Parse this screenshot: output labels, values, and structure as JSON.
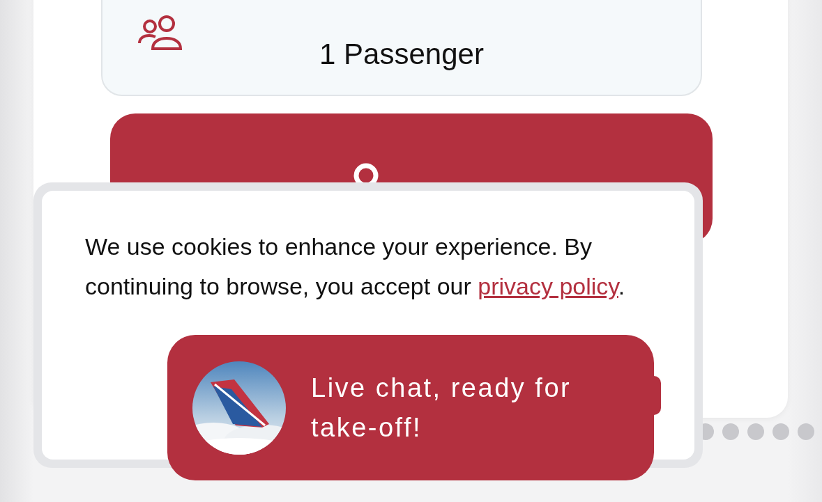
{
  "booking_form": {
    "passengers_field": {
      "value": "1 Passenger"
    }
  },
  "cookie_banner": {
    "text_before": "We use cookies to enhance your experience. By continuing to browse, you accept our ",
    "link": "privacy policy",
    "text_after": "."
  },
  "chat_launcher": {
    "message": "Live chat, ready for take-off!"
  }
}
